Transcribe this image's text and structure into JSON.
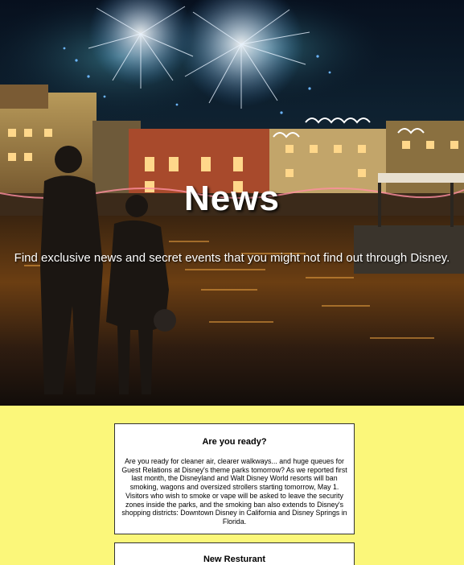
{
  "hero": {
    "title": "News",
    "subtitle": "Find exclusive news and secret events that you might not find out through Disney."
  },
  "articles": [
    {
      "title": "Are you ready?",
      "body": "Are you ready for cleaner air, clearer walkways... and huge queues for Guest Relations at Disney's theme parks tomorrow? As we reported first last month, the Disneyland and Walt Disney World resorts will ban smoking, wagons and oversized strollers starting tomorrow, May 1. Visitors who wish to smoke or vape will be asked to leave the security zones inside the parks, and the smoking ban also extends to Disney's shopping districts: Downtown Disney in California and Disney Springs in Florida."
    },
    {
      "title": "New Resturant",
      "body": ""
    }
  ],
  "colors": {
    "page_background": "#fbf77a",
    "card_background": "#ffffff",
    "card_border": "#333333"
  }
}
